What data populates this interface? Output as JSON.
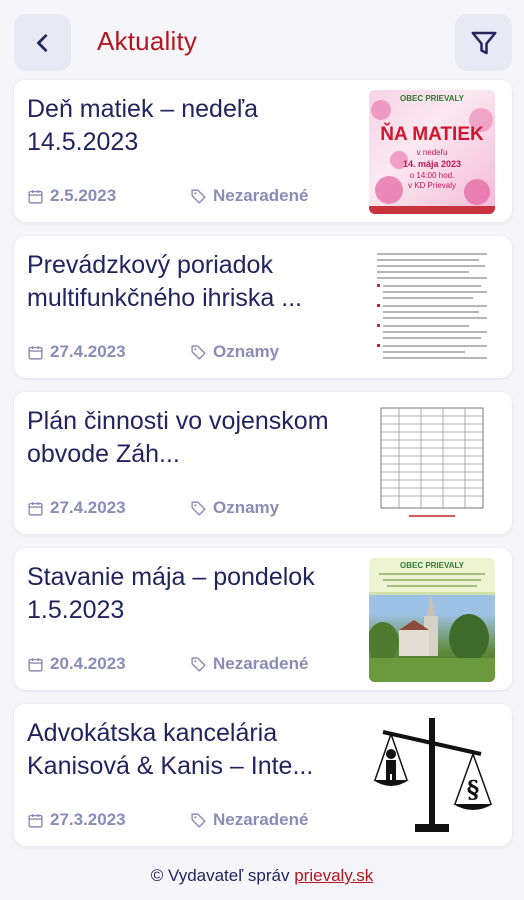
{
  "header": {
    "title": "Aktuality",
    "back_icon": "chevron-left-icon",
    "filter_icon": "filter-icon"
  },
  "articles": [
    {
      "title": "Deň matiek – nedeľa 14.5.2023",
      "date": "2.5.2023",
      "category": "Nezaradené",
      "thumb_text": [
        "OBEC PRIEVALY",
        "ŇA MATIEK",
        "v nedeľu",
        "14. mája 2023",
        "o 14:00 hod.",
        "v KD Prievaly"
      ]
    },
    {
      "title": "Prevádzkový poriadok multifunkčného ihriska ...",
      "date": "27.4.2023",
      "category": "Oznamy"
    },
    {
      "title": "Plán činnosti vo vojenskom obvode Záh...",
      "date": "27.4.2023",
      "category": "Oznamy"
    },
    {
      "title": "Stavanie mája – pondelok 1.5.2023",
      "date": "20.4.2023",
      "category": "Nezaradené",
      "thumb_text": [
        "OBEC PRIEVALY"
      ]
    },
    {
      "title": "Advokátska kancelária Kanisová & Kanis – Inte...",
      "date": "27.3.2023",
      "category": "Nezaradené"
    }
  ],
  "footer": {
    "prefix": "© Vydavateľ správ",
    "link": "prievaly.sk"
  },
  "colors": {
    "accent": "#b3161e",
    "text": "#23245e",
    "meta": "#8a8cb6",
    "background": "#f6f6fa",
    "button_bg": "#e9e9f5"
  }
}
